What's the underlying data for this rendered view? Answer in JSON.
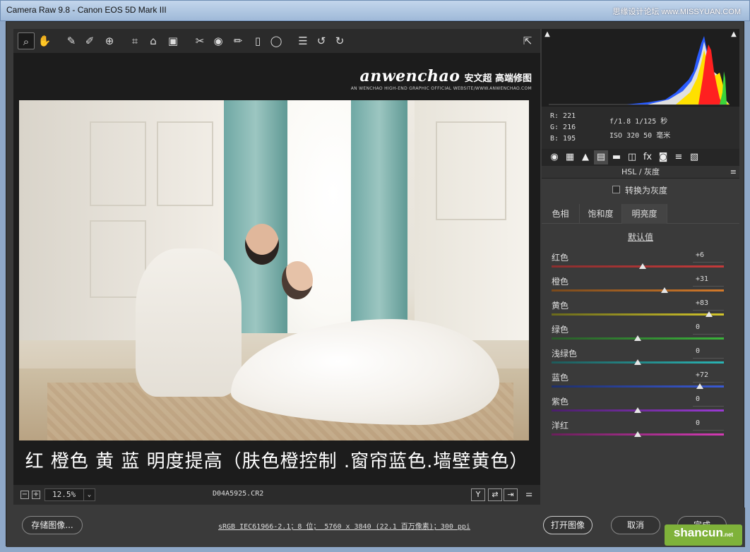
{
  "window": {
    "title": "Camera Raw 9.8 -  Canon EOS 5D Mark III",
    "watermark": "思缘设计论坛 www.MISSYUAN.COM"
  },
  "toolbar": {
    "tools": [
      {
        "name": "zoom-tool-icon",
        "glyph": "⌕"
      },
      {
        "name": "hand-tool-icon",
        "glyph": "✋"
      },
      {
        "name": "white-balance-tool-icon",
        "glyph": "✎"
      },
      {
        "name": "color-sampler-tool-icon",
        "glyph": "✐"
      },
      {
        "name": "targeted-adjustment-tool-icon",
        "glyph": "⊕"
      },
      {
        "name": "crop-tool-icon",
        "glyph": "⌗"
      },
      {
        "name": "straighten-tool-icon",
        "glyph": "⌂"
      },
      {
        "name": "transform-tool-icon",
        "glyph": "▣"
      },
      {
        "name": "spot-removal-tool-icon",
        "glyph": "✂"
      },
      {
        "name": "red-eye-tool-icon",
        "glyph": "◉"
      },
      {
        "name": "adjustment-brush-icon",
        "glyph": "✏"
      },
      {
        "name": "graduated-filter-icon",
        "glyph": "▯"
      },
      {
        "name": "radial-filter-icon",
        "glyph": "◯"
      },
      {
        "name": "preferences-icon",
        "glyph": "☰"
      },
      {
        "name": "rotate-left-icon",
        "glyph": "↺"
      },
      {
        "name": "rotate-right-icon",
        "glyph": "↻"
      }
    ],
    "fullscreen_glyph": "⇱"
  },
  "brand": {
    "name": "anwenchao",
    "cn": "安文超 高端修图",
    "sub": "AN WENCHAO HIGH-END GRAPHIC OFFICIAL WEBSITE/WWW.ANWENCHAO.COM"
  },
  "caption": "红 橙色 黄 蓝 明度提高（肤色橙控制 .窗帘蓝色.墙壁黄色）",
  "status": {
    "zoom": "12.5%",
    "zoom_caret": "⌄",
    "filename": "D04A5925.CR2",
    "minus": "−",
    "plus": "+",
    "view_buttons": [
      "Y",
      "⇄",
      "⇥",
      "⚌"
    ]
  },
  "histogram": {
    "clip_shadow": "▲",
    "clip_highlight": "▲"
  },
  "readout": {
    "r": "R:  221",
    "g": "G:  216",
    "b": "B:  195",
    "exif1": "f/1.8   1/125 秒",
    "exif2": "ISO 320   50 毫米"
  },
  "panel_tabs": [
    "◉",
    "▦",
    "▲",
    "▤",
    "▬",
    "◫",
    "fx",
    "◙",
    "≡",
    "▧"
  ],
  "panel": {
    "title": "HSL / 灰度",
    "menu_glyph": "≡",
    "convert_label": "转换为灰度",
    "subtabs": [
      "色相",
      "饱和度",
      "明亮度"
    ],
    "default_label": "默认值"
  },
  "sliders": [
    {
      "label": "红色",
      "value": "+6",
      "num": 6
    },
    {
      "label": "橙色",
      "value": "+31",
      "num": 31
    },
    {
      "label": "黄色",
      "value": "+83",
      "num": 83
    },
    {
      "label": "绿色",
      "value": "0",
      "num": 0
    },
    {
      "label": "浅绿色",
      "value": "0",
      "num": 0
    },
    {
      "label": "蓝色",
      "value": "+72",
      "num": 72
    },
    {
      "label": "紫色",
      "value": "0",
      "num": 0
    },
    {
      "label": "洋红",
      "value": "0",
      "num": 0
    }
  ],
  "slider_gradients": [
    [
      "#8a2f2f",
      "#c53a3a"
    ],
    [
      "#7a4a1c",
      "#d47a2a"
    ],
    [
      "#6a6a1c",
      "#d4c62a"
    ],
    [
      "#2a5a2a",
      "#3ab43a"
    ],
    [
      "#1f5a5a",
      "#2ab4b4"
    ],
    [
      "#1f2f6a",
      "#3a5ad4"
    ],
    [
      "#4a1f6a",
      "#9a3ad4"
    ],
    [
      "#6a1f5a",
      "#d43ab4"
    ]
  ],
  "bottom": {
    "save": "存储图像...",
    "workflow": "sRGB IEC61966-2.1；8 位； 5760 x 3840 (22.1 百万像素)；300 ppi",
    "open": "打开图像",
    "cancel": "取消",
    "done": "完成",
    "logo": "shancun",
    "logo_small": ".net"
  }
}
